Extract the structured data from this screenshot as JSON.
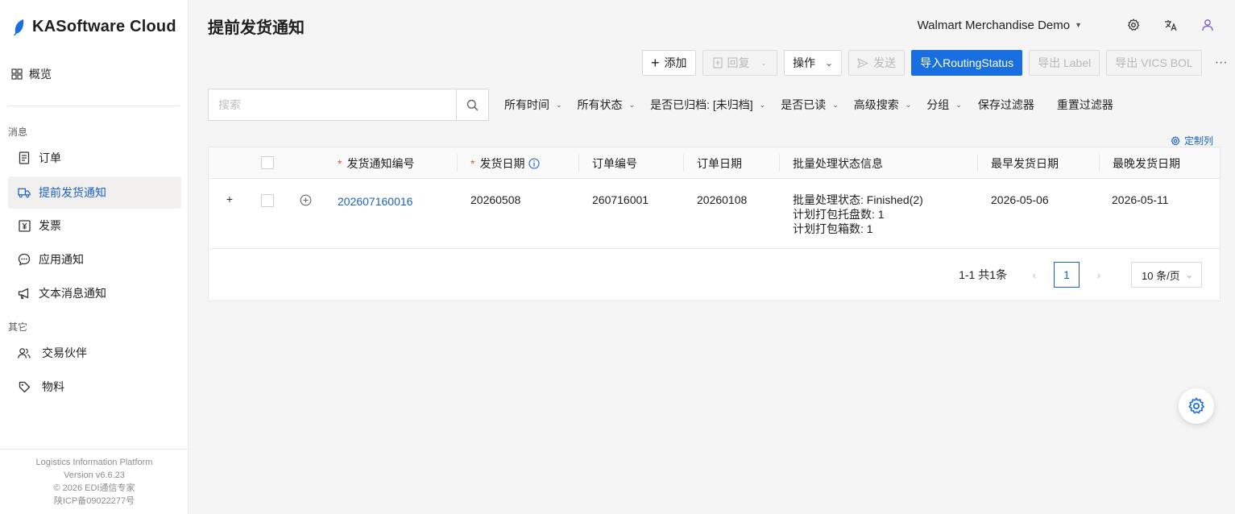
{
  "app": {
    "brand": "KASoftware Cloud"
  },
  "sidebar": {
    "overview": "概览",
    "section_messages": "消息",
    "items": [
      {
        "label": "订单",
        "icon": "document-icon"
      },
      {
        "label": "提前发货通知",
        "icon": "truck-icon",
        "active": true
      },
      {
        "label": "发票",
        "icon": "invoice-icon"
      },
      {
        "label": "应用通知",
        "icon": "chat-icon"
      },
      {
        "label": "文本消息通知",
        "icon": "megaphone-icon"
      }
    ],
    "section_other": "其它",
    "other_items": [
      {
        "label": "交易伙伴",
        "icon": "users-icon"
      },
      {
        "label": "物料",
        "icon": "tag-icon"
      }
    ],
    "footer": {
      "line1": "Logistics Information Platform",
      "line2": "Version v6.6.23",
      "line3": "© 2026 EDI通信专家",
      "line4": "陕ICP备09022277号"
    }
  },
  "header": {
    "title": "提前发货通知",
    "tenant": "Walmart Merchandise Demo"
  },
  "toolbar": {
    "add": "添加",
    "reply": "回复",
    "actions": "操作",
    "send": "发送",
    "import_routing": "导入RoutingStatus",
    "export_label": "导出 Label",
    "export_vics": "导出 VICS BOL",
    "more": "···"
  },
  "filters": {
    "search_placeholder": "搜索",
    "all_time": "所有时间",
    "all_status": "所有状态",
    "archived": "是否已归档: [未归档]",
    "read": "是否已读",
    "advanced": "高级搜索",
    "group": "分组",
    "save_filter": "保存过滤器",
    "reset_filter": "重置过滤器"
  },
  "custom_columns": "定制列",
  "table": {
    "headers": [
      "发货通知编号",
      "发货日期",
      "订单编号",
      "订单日期",
      "批量处理状态信息",
      "最早发货日期",
      "最晚发货日期"
    ],
    "rows": [
      {
        "asn_no": "202607160016",
        "ship_date": "20260508",
        "order_no": "260716001",
        "order_date": "20260108",
        "batch_status": "批量处理状态: Finished(2)",
        "pallets": "计划打包托盘数: 1",
        "cartons": "计划打包箱数: 1",
        "earliest": "2026-05-06",
        "latest": "2026-05-11"
      }
    ]
  },
  "pagination": {
    "total": "1-1 共1条",
    "current_page": "1",
    "page_size": "10 条/页"
  },
  "colors": {
    "accent": "#1a62c7",
    "primary_button": "#1a6fe0",
    "required": "#e25b2a"
  }
}
